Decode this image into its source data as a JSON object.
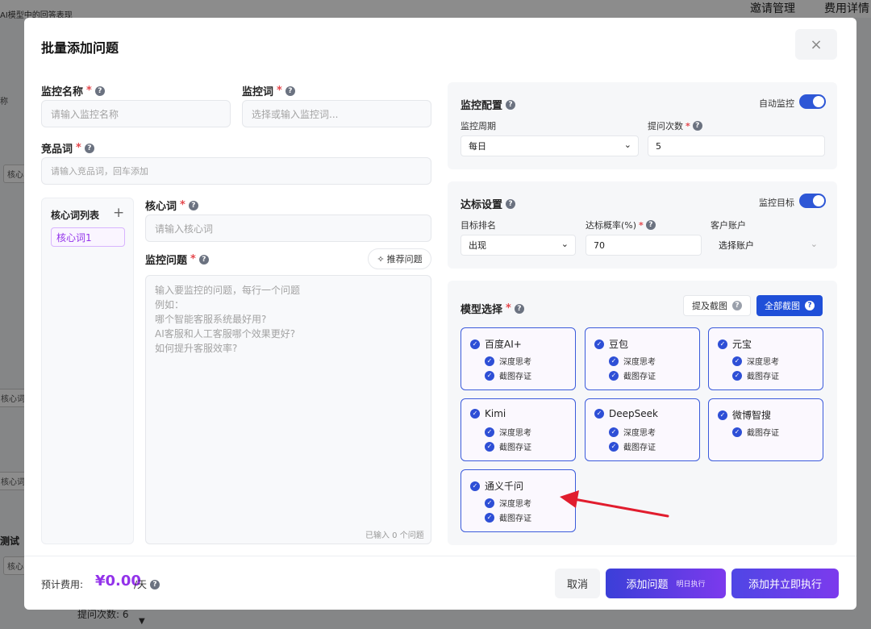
{
  "background": {
    "title": "AI模型中的回答表现",
    "nav": [
      "邀请管理",
      "费用详情"
    ],
    "fragments": [
      "称",
      "核心",
      "核心词",
      "核心词",
      "核心",
      "测试",
      "提问次数: 6"
    ]
  },
  "modal": {
    "title": "批量添加问题",
    "close_icon": "×"
  },
  "form": {
    "name": {
      "label": "监控名称",
      "placeholder": "请输入监控名称"
    },
    "keyword": {
      "label": "监控词",
      "placeholder": "选择或输入监控词..."
    },
    "competitor": {
      "label": "竞品词",
      "placeholder": "请输入竞品词，回车添加"
    },
    "keyword_list": {
      "title": "核心词列表",
      "add_icon": "+",
      "items": [
        "核心词1"
      ]
    },
    "core_word": {
      "label": "核心词",
      "placeholder": "请输入核心词"
    },
    "questions": {
      "label": "监控问题",
      "recommend_button": "推荐问题",
      "placeholder": "输入要监控的问题，每行一个问题\n例如：\n哪个智能客服系统最好用?\nAI客服和人工客服哪个效果更好?\n如何提升客服效率?",
      "count_text": "已输入 0 个问题"
    }
  },
  "monitor_config": {
    "title": "监控配置",
    "auto_label": "自动监控",
    "auto_on": true,
    "period_label": "监控周期",
    "period_value": "每日",
    "times_label": "提问次数",
    "times_value": "5"
  },
  "target_settings": {
    "title": "达标设置",
    "target_label": "监控目标",
    "target_on": true,
    "rank_label": "目标排名",
    "rank_value": "出现",
    "prob_label": "达标概率(%)",
    "prob_value": "70",
    "account_label": "客户账户",
    "account_value": "选择账户"
  },
  "model_select": {
    "title": "模型选择",
    "mention_button": "提及截图",
    "all_button": "全部截图",
    "models": [
      {
        "name": "百度AI+",
        "options": [
          "深度思考",
          "截图存证"
        ]
      },
      {
        "name": "豆包",
        "options": [
          "深度思考",
          "截图存证"
        ]
      },
      {
        "name": "元宝",
        "options": [
          "深度思考",
          "截图存证"
        ]
      },
      {
        "name": "Kimi",
        "options": [
          "深度思考",
          "截图存证"
        ]
      },
      {
        "name": "DeepSeek",
        "options": [
          "深度思考",
          "截图存证"
        ]
      },
      {
        "name": "微博智搜",
        "options": [
          "截图存证"
        ]
      },
      {
        "name": "通义千问",
        "options": [
          "深度思考",
          "截图存证"
        ]
      }
    ]
  },
  "footer": {
    "cost_label": "预计费用:",
    "cost_value": "¥0.00",
    "cost_unit": "/天",
    "cancel": "取消",
    "add": "添加问题",
    "add_tag": "明日执行",
    "add_exec": "添加并立即执行"
  },
  "colors": {
    "accent": "#2e57d6",
    "purple": "#9333ea",
    "annotation": "#e11d2e"
  }
}
